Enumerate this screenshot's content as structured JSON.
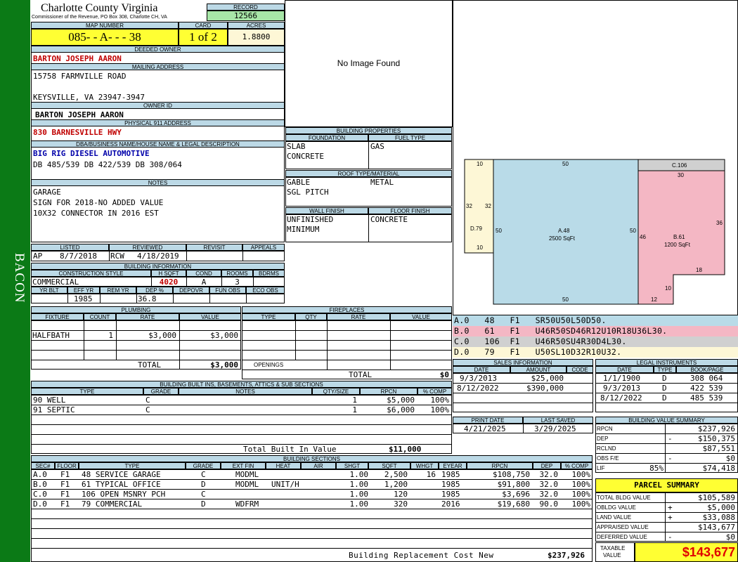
{
  "sidebar": {
    "label": "BACON",
    "color": "#0b7a16"
  },
  "header": {
    "county": "Charlotte County Virginia",
    "commissioner": "Commissioner of the Revenue, PO Box 308, Charlotte CH, VA",
    "record_label": "RECORD",
    "record": "12566",
    "map_label": "MAP NUMBER",
    "map_number": "085- - A- - - 38",
    "card_label": "CARD",
    "card": "1 of 2",
    "acres_label": "ACRES",
    "acres": "1.8800"
  },
  "owner": {
    "deeded_label": "DEEDED OWNER",
    "deeded": "BARTON JOSEPH AARON",
    "mailing_label": "MAILING ADDRESS",
    "addr1": "15758 FARMVILLE ROAD",
    "addr2": "KEYSVILLE, VA 23947-3947",
    "ownerid_label": "OWNER ID",
    "ownerid": "BARTON JOSEPH AARON",
    "phys_label": "PHYSICAL 911 ADDRESS",
    "phys": "830 BARNESVILLE HWY",
    "dba_label": "DBA/BUSINESS NAME/HOUSE NAME & LEGAL DESCRIPTION",
    "dba": "BIG RIG DIESEL AUTOMOTIVE",
    "legal": "DB 485/539 DB 422/539 DB 308/064"
  },
  "notes": {
    "label": "NOTES",
    "lines": [
      "GARAGE",
      "SIGN FOR 2018-NO ADDED VALUE",
      "10X32 CONNECTOR IN 2016 EST"
    ]
  },
  "status": {
    "listed_label": "LISTED",
    "reviewed_label": "REVIEWED",
    "revisit_label": "REVISIT",
    "appeals_label": "APPEALS",
    "listed_by": "AP",
    "listed": "8/7/2018",
    "reviewed_by": "RCW",
    "reviewed": "4/18/2019"
  },
  "building_info": {
    "label": "BUILDING INFORMATION",
    "h_cons": "CONSTRUCTION STYLE",
    "h_hsqft": "H SQFT",
    "h_cond": "COND",
    "h_rooms": "ROOMS",
    "h_bdrms": "BDRMS",
    "cons": "COMMERCIAL",
    "hsqft": "4020",
    "cond": "A",
    "rooms": "3",
    "h_yrblt": "YR BLT",
    "h_effyr": "EFF YR",
    "h_remyr": "REM YR",
    "h_dep": "DEP %",
    "h_depovr": "DEPOVR",
    "h_funobs": "FUN OBS",
    "h_ecoobs": "ECO OBS",
    "effyr": "1985",
    "dep": "36.8"
  },
  "image": {
    "text": "No Image Found"
  },
  "props": {
    "label": "BUILDING PROPERTIES",
    "h_found": "FOUNDATION",
    "h_fuel": "FUEL TYPE",
    "found1": "SLAB",
    "found2": "CONCRETE",
    "fuel": "GAS",
    "h_roof": "ROOF TYPE/MATERIAL",
    "roof1": "GABLE",
    "roof2": "SGL PITCH",
    "roofmat": "METAL",
    "h_wall": "WALL FINISH",
    "h_floor": "FLOOR FINISH",
    "wall1": "UNFINISHED",
    "wall2": "MINIMUM",
    "floor": "CONCRETE"
  },
  "sketch": {
    "A_label": "A.48",
    "A_area": "2500 SqFt",
    "B_label": "B.61",
    "B_area": "1200 SqFt",
    "C_label": "C.106",
    "D_label": "D.79",
    "d10a": "10",
    "d50a": "50",
    "d30": "30",
    "d32a": "32",
    "d32b": "32",
    "d50b": "50",
    "d50c": "50",
    "d46": "46",
    "d36": "36",
    "d10b": "10",
    "d18": "18",
    "d10c": "10",
    "d12": "12",
    "d50d": "50",
    "colA": "#b9dbe8",
    "colB": "#f4b7c4",
    "colC": "#d0d0d0",
    "colD": "#fdf7d6"
  },
  "sections_legend": [
    {
      "text": "A.0   48   F1   SR50U50L50D50.",
      "color": "#b9dbe8"
    },
    {
      "text": "B.0   61   F1   U46R50SD46R12U10R18U36L30.",
      "color": "#f4b7c4"
    },
    {
      "text": "C.0   106  F1   U46R50SU4R30D4L30.",
      "color": "#d0d0d0"
    },
    {
      "text": "D.0   79   F1   U50SL10D32R10U32.",
      "color": "#fdf7d6"
    }
  ],
  "plumbing": {
    "label": "PLUMBING",
    "h_fixture": "FIXTURE",
    "h_count": "COUNT",
    "h_rate": "RATE",
    "h_value": "VALUE",
    "fixture": "HALFBATH",
    "count": "1",
    "rate": "$3,000",
    "value": "$3,000",
    "total_label": "TOTAL",
    "total": "$3,000"
  },
  "fireplaces": {
    "label": "FIREPLACES",
    "h_type": "TYPE",
    "h_qty": "QTY",
    "h_rate": "RATE",
    "h_value": "VALUE",
    "openings": "OPENINGS",
    "total_label": "TOTAL",
    "total": "$0"
  },
  "builtins": {
    "label": "BUILDING BUILT INS, BASEMENTS, ATTICS & SUB SECTIONS",
    "h_type": "TYPE",
    "h_grade": "GRADE",
    "h_notes": "NOTES",
    "h_qty": "QTY/SIZE",
    "h_rpcn": "RPCN",
    "h_comp": "% COMP",
    "rows": [
      {
        "type": "90 WELL",
        "grade": "C",
        "qty": "1",
        "rpcn": "$5,000",
        "comp": "100%"
      },
      {
        "type": "91 SEPTIC",
        "grade": "C",
        "qty": "1",
        "rpcn": "$6,000",
        "comp": "100%"
      }
    ],
    "total_label": "Total Built In Value",
    "total": "$11,000"
  },
  "sales": {
    "label": "SALES INFORMATION",
    "h_date": "DATE",
    "h_amount": "AMOUNT",
    "h_code": "CODE",
    "rows": [
      {
        "date": "9/3/2013",
        "amount": "$25,000"
      },
      {
        "date": "8/12/2022",
        "amount": "$390,000"
      }
    ]
  },
  "legal": {
    "label": "LEGAL INSTRUMENTS",
    "h_date": "DATE",
    "h_type": "TYPE",
    "h_book": "BOOK/PAGE",
    "rows": [
      {
        "date": "1/1/1900",
        "type": "D",
        "book": "308 064"
      },
      {
        "date": "9/3/2013",
        "type": "D",
        "book": "422 539"
      },
      {
        "date": "8/12/2022",
        "type": "D",
        "book": "485 539"
      }
    ]
  },
  "dates": {
    "print_label": "PRINT DATE",
    "print": "4/21/2025",
    "saved_label": "LAST SAVED",
    "saved": "3/29/2025"
  },
  "bvs": {
    "label": "BUILDING VALUE SUMMARY",
    "rows": [
      {
        "k": "RPCN",
        "s": "",
        "v": "$237,926"
      },
      {
        "k": "DEP",
        "s": "-",
        "v": "$150,375"
      },
      {
        "k": "RCLND",
        "s": "",
        "v": "$87,551"
      },
      {
        "k": "OBS F/E",
        "s": "-",
        "v": "$0"
      },
      {
        "k": "LIF",
        "s": "85%",
        "v": "$74,418"
      }
    ]
  },
  "parcel": {
    "label": "PARCEL SUMMARY",
    "rows": [
      {
        "k": "TOTAL BLDG VALUE",
        "s": "",
        "v": "$105,589"
      },
      {
        "k": "OBLDG VALUE",
        "s": "+",
        "v": "$5,000"
      },
      {
        "k": "LAND VALUE",
        "s": "+",
        "v": "$33,088"
      },
      {
        "k": "APPRAISED VALUE",
        "s": "",
        "v": "$143,677"
      },
      {
        "k": "DEFERRED VALUE",
        "s": "-",
        "v": "$0"
      }
    ],
    "taxable_label1": "TAXABLE",
    "taxable_label2": "VALUE",
    "taxable": "$143,677"
  },
  "sections": {
    "label": "BUILDING SECTIONS",
    "h": [
      "SEC#",
      "FLOOR",
      "TYPE",
      "GRADE",
      "EXT FIN",
      "HEAT",
      "AIR",
      "SHGT",
      "SQFT",
      "WHGT",
      "EYEAR",
      "RPCN",
      "DEP",
      "% COMP"
    ],
    "rows": [
      {
        "sec": "A.0",
        "floor": "F1",
        "type": "48 SERVICE GARAGE",
        "grade": "C",
        "ext": "MODML",
        "heat": "",
        "shgt": "1.00",
        "sqft": "2,500",
        "whgt": "16",
        "eyear": "1985",
        "rpcn": "$108,750",
        "dep": "32.0",
        "comp": "100%"
      },
      {
        "sec": "B.0",
        "floor": "F1",
        "type": "61 TYPICAL OFFICE",
        "grade": "D",
        "ext": "MODML",
        "heat": "UNIT/H",
        "shgt": "1.00",
        "sqft": "1,200",
        "whgt": "",
        "eyear": "1985",
        "rpcn": "$91,800",
        "dep": "32.0",
        "comp": "100%"
      },
      {
        "sec": "C.0",
        "floor": "F1",
        "type": "106 OPEN MSNRY PCH",
        "grade": "C",
        "ext": "",
        "heat": "",
        "shgt": "1.00",
        "sqft": "120",
        "whgt": "",
        "eyear": "1985",
        "rpcn": "$3,696",
        "dep": "32.0",
        "comp": "100%"
      },
      {
        "sec": "D.0",
        "floor": "F1",
        "type": "79 COMMERCIAL",
        "grade": "D",
        "ext": "WDFRM",
        "heat": "",
        "shgt": "1.00",
        "sqft": "320",
        "whgt": "",
        "eyear": "2016",
        "rpcn": "$19,680",
        "dep": "90.0",
        "comp": "100%"
      }
    ],
    "total_label": "Building Replacement Cost New",
    "total": "$237,926"
  }
}
